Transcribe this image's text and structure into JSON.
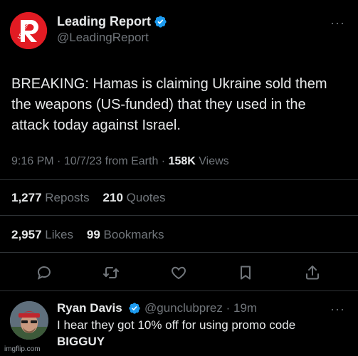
{
  "tweet": {
    "author": {
      "display_name": "Leading Report",
      "handle": "@LeadingReport",
      "avatar_icon": "leading-report-logo",
      "verified": true
    },
    "text": "BREAKING: Hamas is claiming Ukraine sold them the weapons (US-funded) that they used in the attack today against Israel.",
    "meta": {
      "time": "9:16 PM",
      "sep1": " · ",
      "date": "10/7/23",
      "source": " from Earth",
      "sep2": " · ",
      "views_count": "158K",
      "views_label": " Views"
    },
    "stats": {
      "reposts_count": "1,277",
      "reposts_label": " Reposts",
      "quotes_count": "210",
      "quotes_label": " Quotes",
      "likes_count": "2,957",
      "likes_label": " Likes",
      "bookmarks_count": "99",
      "bookmarks_label": " Bookmarks"
    },
    "actions": [
      "reply-icon",
      "repost-icon",
      "like-icon",
      "bookmark-icon",
      "share-icon"
    ],
    "more_label": "···"
  },
  "reply": {
    "display_name": "Ryan Davis",
    "handle": "@gunclubprez",
    "sep": " · ",
    "age": "19m",
    "verified": true,
    "line1": "I hear they got 10% off for using promo code",
    "line2": "BIGGUY",
    "more_label": "···"
  },
  "watermark": "imgflip.com",
  "colors": {
    "background": "#000000",
    "text_primary": "#e7e9ea",
    "text_muted": "#71767b",
    "verified": "#1d9bf0",
    "logo_red": "#e21b23",
    "divider": "#2f3336"
  }
}
